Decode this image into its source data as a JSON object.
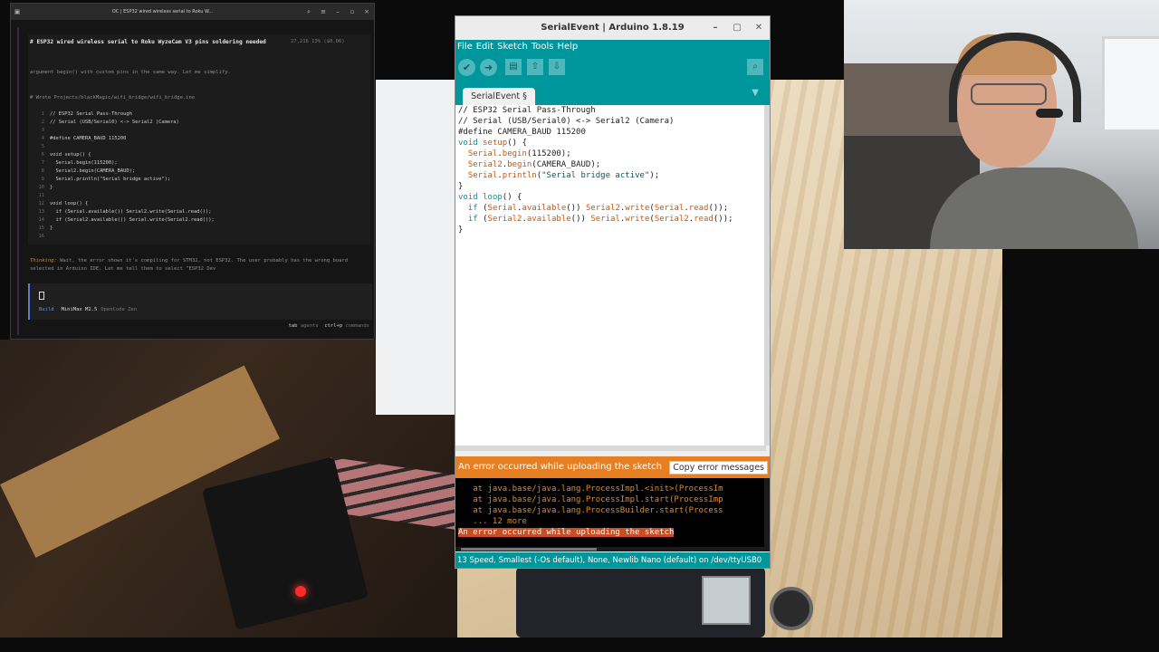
{
  "terminal": {
    "title": "OC | ESP32 wired wireless serial to Roku W...",
    "heading": "# ESP32 wired wireless serial to Roku WyzeCam V3 pins soldering needed",
    "tokens": "27,216  13% ($0.06)",
    "arg_line": "argument begin() with custom pins in the same way. Let me simplify.",
    "wrote_line": "# Wrote Projects/blackMagic/wifi_bridge/wifi_bridge.ino",
    "code_lines": [
      {
        "n": "1",
        "t": "// ESP32 Serial Pass-Through"
      },
      {
        "n": "2",
        "t": "// Serial (USB/Serial0) <-> Serial2 (Camera)"
      },
      {
        "n": "3",
        "t": ""
      },
      {
        "n": "4",
        "t": "#define CAMERA_BAUD 115200"
      },
      {
        "n": "5",
        "t": ""
      },
      {
        "n": "6",
        "t": "void setup() {"
      },
      {
        "n": "7",
        "t": "  Serial.begin(115200);"
      },
      {
        "n": "8",
        "t": "  Serial2.begin(CAMERA_BAUD);"
      },
      {
        "n": "9",
        "t": "  Serial.println(\"Serial bridge active\");"
      },
      {
        "n": "10",
        "t": "}"
      },
      {
        "n": "11",
        "t": ""
      },
      {
        "n": "12",
        "t": "void loop() {"
      },
      {
        "n": "13",
        "t": "  if (Serial.available()) Serial2.write(Serial.read());"
      },
      {
        "n": "14",
        "t": "  if (Serial2.available()) Serial.write(Serial2.read());"
      },
      {
        "n": "15",
        "t": "}"
      },
      {
        "n": "16",
        "t": ""
      }
    ],
    "thinking_label": "Thinking:",
    "thinking_text": " Wait, the error shows it's compiling for STM32, not ESP32. The user probably has the wrong board selected in Arduino IDE. Let me tell them to select \"ESP32 Dev",
    "mode": "Build",
    "model": "MiniMax M2.5",
    "provider": "OpenCode Zen",
    "shortcut_tab_key": "tab",
    "shortcut_tab_label": "agents",
    "shortcut_cmd_key": "ctrl+p",
    "shortcut_cmd_label": "commands"
  },
  "arduino": {
    "title": "SerialEvent | Arduino 1.8.19",
    "menu": [
      "File",
      "Edit",
      "Sketch",
      "Tools",
      "Help"
    ],
    "tab_label": "SerialEvent §",
    "status_text": "An error occurred while uploading the sketch",
    "copy_button": "Copy error messages",
    "console_lines": [
      "   at java.base/java.lang.ProcessImpl.<init>(ProcessIm",
      "   at java.base/java.lang.ProcessImpl.start(ProcessImp",
      "   at java.base/java.lang.ProcessBuilder.start(Process",
      "   ... 12 more"
    ],
    "console_error": "An error occurred while uploading the sketch",
    "board_status": "Speed, Smallest (-Os default), None, Newlib Nano (default) on /dev/ttyUSB0",
    "board_line_number": "13"
  },
  "colors": {
    "arduino_teal": "#00979c",
    "arduino_orange": "#e67e22",
    "terminal_bg": "#151515"
  }
}
